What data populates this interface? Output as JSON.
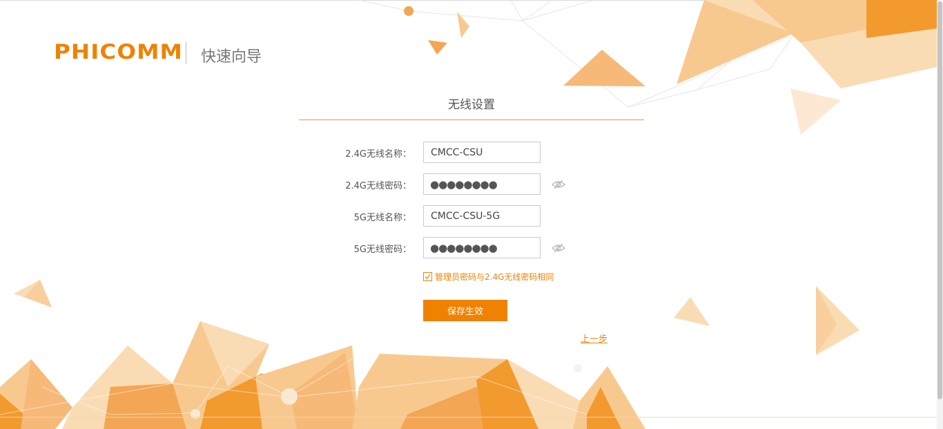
{
  "header": {
    "logo_text": "PHICOMM",
    "wizard_title": "快速向导"
  },
  "section": {
    "title": "无线设置"
  },
  "form": {
    "ssid_24_label": "2.4G无线名称：",
    "ssid_24_value": "CMCC-CSU",
    "pwd_24_label": "2.4G无线密码：",
    "pwd_24_masked": "●●●●●●●●",
    "ssid_5_label": "5G无线名称：",
    "ssid_5_value": "CMCC-CSU-5G",
    "pwd_5_label": "5G无线密码：",
    "pwd_5_masked": "●●●●●●●●",
    "same_as_admin_label": "管理员密码与2.4G无线密码相同",
    "same_as_admin_checked": true
  },
  "actions": {
    "save_label": "保存生效",
    "back_label": "上一步"
  },
  "icons": {
    "password_toggle": "eye-off-icon",
    "checkbox": "checkmark-icon"
  },
  "colors": {
    "accent": "#ef8200",
    "accent_light": "#f9d9ae",
    "text": "#555555"
  }
}
